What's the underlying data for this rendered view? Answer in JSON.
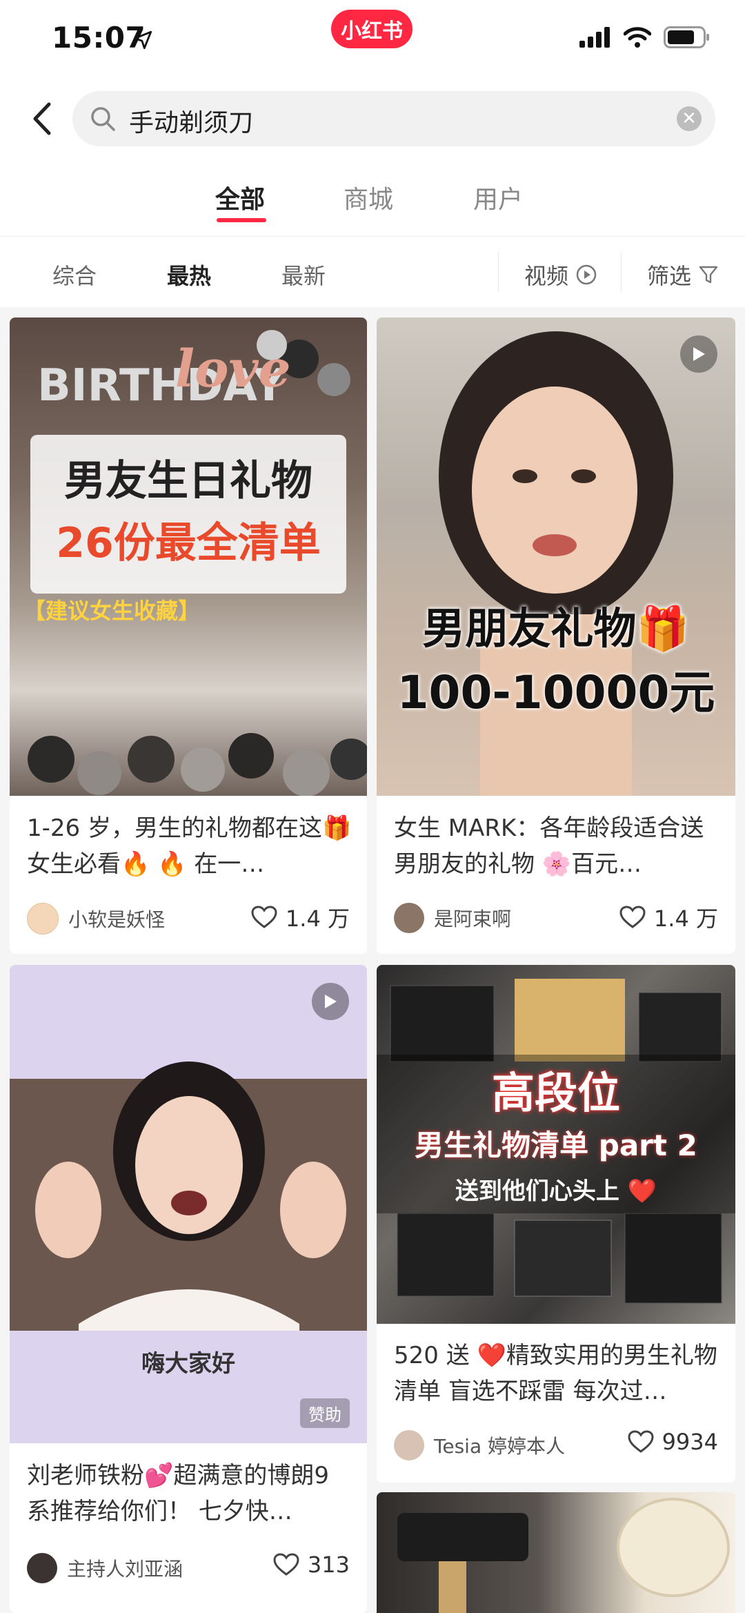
{
  "status": {
    "time": "15:07",
    "app_badge": "小红书"
  },
  "search": {
    "query": "手动剃须刀"
  },
  "tabs": [
    {
      "label": "全部",
      "active": true
    },
    {
      "label": "商城",
      "active": false
    },
    {
      "label": "用户",
      "active": false
    }
  ],
  "sort": {
    "options": [
      {
        "label": "综合",
        "active": false
      },
      {
        "label": "最热",
        "active": true
      },
      {
        "label": "最新",
        "active": false
      }
    ],
    "video_label": "视频",
    "filter_label": "筛选"
  },
  "notes": [
    {
      "image_title": "男友生日礼物",
      "image_subtitle": "26份最全清单",
      "image_tag": "【建议女生收藏】",
      "title": "1-26 岁，男生的礼物都在这🎁女生必看🔥 🔥 在一…",
      "author": "小软是妖怪",
      "likes": "1.4 万",
      "video": false
    },
    {
      "image_title": "男朋友礼物🎁",
      "image_subtitle": "100-10000元",
      "title": "女生 MARK：各年龄段适合送男朋友的礼物 🌸百元…",
      "author": "是阿束啊",
      "likes": "1.4 万",
      "video": true
    },
    {
      "image_caption": "嗨大家好",
      "sponsor": "赞助",
      "title": "刘老师铁粉💕超满意的博朗9 系推荐给你们！ 七夕快…",
      "author": "主持人刘亚涵",
      "likes": "313",
      "video": true
    },
    {
      "image_title": "高段位",
      "image_subtitle": "男生礼物清单 part 2",
      "image_tag": "送到他们心头上 ❤️",
      "title": "520 送 ❤️精致实用的男生礼物清单 盲选不踩雷 每次过…",
      "author": "Tesia 婷婷本人",
      "likes": "9934",
      "video": false
    }
  ],
  "colors": {
    "accent": "#ff2741",
    "background": "#f5f5f5"
  }
}
